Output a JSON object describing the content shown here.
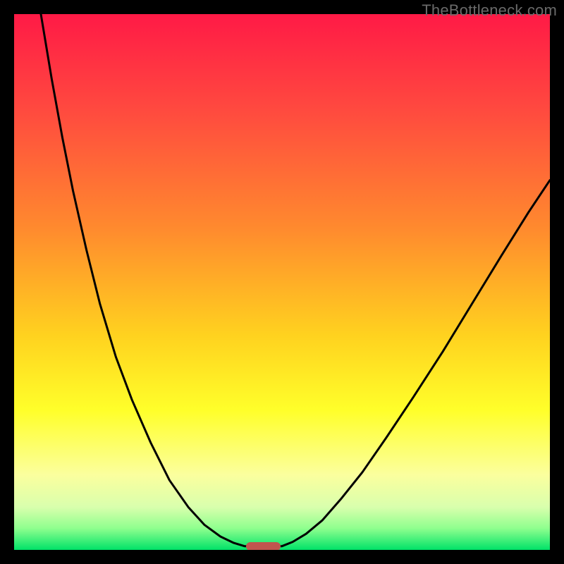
{
  "watermark": {
    "text": "TheBottleneck.com"
  },
  "colors": {
    "frame": "#000000",
    "curve": "#000000",
    "marker": "#c1554e",
    "gradient_stops": [
      {
        "pct": 0,
        "color": "#ff1a46"
      },
      {
        "pct": 18,
        "color": "#ff4a3f"
      },
      {
        "pct": 40,
        "color": "#ff8a2e"
      },
      {
        "pct": 60,
        "color": "#ffd21f"
      },
      {
        "pct": 74,
        "color": "#ffff2a"
      },
      {
        "pct": 86,
        "color": "#fbff9e"
      },
      {
        "pct": 92,
        "color": "#d9ffad"
      },
      {
        "pct": 96,
        "color": "#8eff8e"
      },
      {
        "pct": 100,
        "color": "#00e268"
      }
    ]
  },
  "chart_data": {
    "type": "line",
    "title": "",
    "xlabel": "",
    "ylabel": "",
    "xlim": [
      0,
      100
    ],
    "ylim": [
      0,
      100
    ],
    "curve_points_norm": [
      [
        0.05,
        0.0
      ],
      [
        0.07,
        0.12
      ],
      [
        0.09,
        0.23
      ],
      [
        0.11,
        0.33
      ],
      [
        0.135,
        0.44
      ],
      [
        0.16,
        0.54
      ],
      [
        0.19,
        0.64
      ],
      [
        0.22,
        0.72
      ],
      [
        0.255,
        0.8
      ],
      [
        0.29,
        0.87
      ],
      [
        0.325,
        0.92
      ],
      [
        0.355,
        0.953
      ],
      [
        0.385,
        0.975
      ],
      [
        0.41,
        0.987
      ],
      [
        0.43,
        0.993
      ],
      [
        0.5,
        0.993
      ],
      [
        0.52,
        0.985
      ],
      [
        0.545,
        0.97
      ],
      [
        0.575,
        0.945
      ],
      [
        0.61,
        0.905
      ],
      [
        0.65,
        0.855
      ],
      [
        0.695,
        0.79
      ],
      [
        0.745,
        0.715
      ],
      [
        0.8,
        0.63
      ],
      [
        0.855,
        0.54
      ],
      [
        0.91,
        0.45
      ],
      [
        0.96,
        0.37
      ],
      [
        1.0,
        0.31
      ]
    ],
    "marker_norm": {
      "x_center": 0.465,
      "width": 0.065,
      "y": 0.993
    },
    "notes": "x,y normalized 0..1 within plot area; y=0 top, y=1 bottom. Curve is a V-shaped two-branch line chart over a vertical red→green gradient; a small rounded marker sits at the valley floor."
  }
}
